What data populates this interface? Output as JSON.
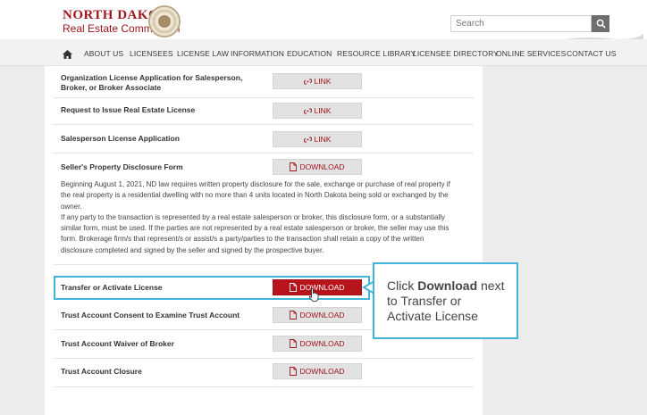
{
  "header": {
    "logo_line1": "NORTH DAKOTA",
    "logo_line2": "Real Estate Commission",
    "search_placeholder": "Search",
    "search_icon": "magnifier-icon"
  },
  "nav": {
    "home_icon": "home-icon",
    "items": [
      "ABOUT US",
      "LICENSEES",
      "LICENSE LAW",
      "INFORMATION",
      "EDUCATION",
      "RESOURCE LIBRARY",
      "LICENSEE DIRECTORY",
      "ONLINE SERVICES",
      "CONTACT US"
    ]
  },
  "rows": [
    {
      "label": "Organization License Application for Salesperson, Broker, or Broker Associate",
      "action": "LINK",
      "icon": "link-icon"
    },
    {
      "label": "Request to Issue Real Estate License",
      "action": "LINK",
      "icon": "link-icon"
    },
    {
      "label": "Salesperson License Application",
      "action": "LINK",
      "icon": "link-icon"
    },
    {
      "label": "Seller's Property Disclosure Form",
      "action": "DOWNLOAD",
      "icon": "document-icon"
    },
    {
      "label": "Transfer or Activate License",
      "action": "DOWNLOAD",
      "icon": "document-icon"
    },
    {
      "label": "Trust Account Consent to Examine Trust Account",
      "action": "DOWNLOAD",
      "icon": "document-icon"
    },
    {
      "label": "Trust Account Waiver of Broker",
      "action": "DOWNLOAD",
      "icon": "document-icon"
    },
    {
      "label": "Trust Account Closure",
      "action": "DOWNLOAD",
      "icon": "document-icon"
    }
  ],
  "disclosure": {
    "para1_l1": "Beginning August 1, 2021, ND law requires written property disclosure for the sale, exchange or purchase of real property if",
    "para1_l2": "the real property is a residential dwelling with no more than 4 units located in North Dakota being sold or exchanged by the",
    "para1_l3": "owner.",
    "para2_l1": "If any party to the transaction is represented by a real estate salesperson or broker, this disclosure form, or a substantially",
    "para2_l2": "similar form, must be used. If the parties are not represented by a real estate salesperson or broker, the seller may use this",
    "para2_l3": "form. Brokerage firm/s that represent/s or assist/s a party/parties to the transaction shall retain a copy of the written",
    "para2_l4": "disclosure completed and signed by the seller and signed by the prospective buyer."
  },
  "callout": {
    "prefix": "Click ",
    "bold": "Download",
    "suffix": " next to Transfer or Activate License"
  },
  "colors": {
    "brand_red": "#a0161d",
    "active_red": "#b8141c",
    "highlight_blue": "#41b4d9"
  }
}
